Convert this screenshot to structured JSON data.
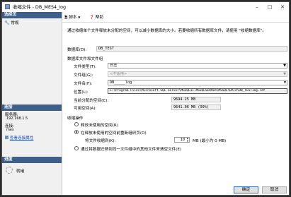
{
  "window": {
    "title": "收缩文件 - DB_MES4_log"
  },
  "sidebar": {
    "select_page_header": "选择页",
    "pages": [
      {
        "label": "常规"
      }
    ],
    "connection_header": "连接",
    "server_label": "服务器:",
    "server_value": "192.168.1.5",
    "connection_label": "连接:",
    "connection_value": "mes",
    "view_props_link": "查看连接属性",
    "progress_header": "进度",
    "progress_status": "就绪"
  },
  "toolbar": {
    "script_label": "脚本",
    "help_label": "帮助"
  },
  "description": "通过收缩单个文件释放未分配的空间，可以减小数据库的大小。若要收缩所有数据库文件，请使用 \"收缩数据库\"。",
  "database": {
    "label": "数据库(D):",
    "value": "DB_TEST"
  },
  "files_section": "数据库文件和文件组",
  "file_type": {
    "label": "文件类型(T):",
    "value": "日志"
  },
  "file_group": {
    "label": "文件组(G):",
    "value": "<不适用>"
  },
  "file_name": {
    "label": "文件名(F):",
    "value": "DB_____log"
  },
  "location": {
    "label": "位置(L):",
    "value": "C:\\Program Files\\Microsoft SQL Server\\MSSQL11.MSSQLSERVER\\MSSQL\\DATA\\DB_TEST1og.ldf"
  },
  "allocated": {
    "label": "当前分配的空间(C):",
    "value": "9694.25 MB"
  },
  "free": {
    "label": "可用空间(A):",
    "value": "9641.06 MB (99%)"
  },
  "shrink_section": "收缩操作",
  "options": {
    "release": "释放未使用的空间(R)",
    "reorganize": "在释放未使用的空间前重新组织页(O)",
    "shrink_to_label": "将文件收缩到(K):",
    "shrink_to_value": "10",
    "shrink_to_unit": "MB (最小为 0 MB)",
    "empty": "通过将数据迁移到同一文件组中的其他文件来清空文件(E)"
  },
  "buttons": {
    "ok": "确定",
    "cancel": "取消"
  }
}
